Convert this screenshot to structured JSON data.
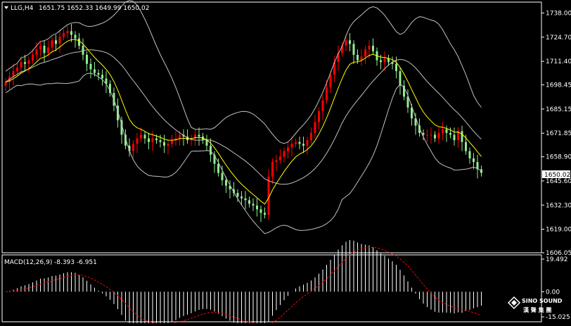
{
  "header": {
    "symbol": "LLG,H4",
    "ohlc": "1651.75 1652.33 1649.99 1650.02"
  },
  "macd_header": {
    "label": "MACD(12,26,9)",
    "values": "-8.393 -6.951"
  },
  "logo": {
    "line1": "SINO SOUND",
    "line2": "漢 聲 集 團"
  },
  "colors": {
    "background": "#000000",
    "frame": "#ffffff",
    "bull_candle": "#ff0000",
    "bear_candle": "#90ee90",
    "bollinger": "#c0c0c0",
    "ma": "#ffff00",
    "macd_hist": "#ffffff",
    "macd_signal": "#ff0000"
  },
  "chart_data": [
    {
      "type": "candlestick",
      "title": "LLG,H4",
      "price_ticks": [
        "1738.00",
        "1724.70",
        "1711.40",
        "1698.45",
        "1685.15",
        "1671.85",
        "1658.90",
        "1645.60",
        "1632.30",
        "1619.00",
        "1606.05"
      ],
      "current_price": "1650.02",
      "ylim": [
        1606.05,
        1744
      ],
      "closes": [
        1700,
        1703,
        1706,
        1708,
        1711,
        1710,
        1712,
        1715,
        1718,
        1720,
        1716,
        1719,
        1723,
        1721,
        1725,
        1727,
        1728,
        1726,
        1724,
        1720,
        1715,
        1710,
        1707,
        1705,
        1704,
        1702,
        1699,
        1694,
        1687,
        1679,
        1671,
        1665,
        1662,
        1666,
        1669,
        1671,
        1669,
        1667,
        1669,
        1668,
        1667,
        1665,
        1666,
        1668,
        1669,
        1671,
        1670,
        1668,
        1669,
        1671,
        1670,
        1668,
        1665,
        1660,
        1655,
        1650,
        1646,
        1643,
        1641,
        1639,
        1637,
        1636,
        1635,
        1633,
        1632,
        1630,
        1628,
        1627,
        1648,
        1656,
        1657,
        1659,
        1662,
        1664,
        1666,
        1667,
        1666,
        1665,
        1668,
        1672,
        1678,
        1684,
        1690,
        1697,
        1704,
        1711,
        1716,
        1720,
        1723,
        1721,
        1715,
        1712,
        1714,
        1718,
        1720,
        1717,
        1712,
        1711,
        1713,
        1711,
        1710,
        1706,
        1698,
        1692,
        1686,
        1680,
        1676,
        1672,
        1671,
        1671,
        1671,
        1669,
        1672,
        1674,
        1672,
        1671,
        1668,
        1673,
        1667,
        1662,
        1658,
        1656,
        1652,
        1650
      ],
      "bollinger": "20-period bands",
      "moving_average": "yellow line"
    },
    {
      "type": "bar",
      "title": "MACD(12,26,9)",
      "main": -8.393,
      "signal": -6.951,
      "y_ticks": [
        "19.492",
        "0.00",
        "-15.025"
      ],
      "ylim": [
        -15.025,
        19.492
      ]
    }
  ]
}
